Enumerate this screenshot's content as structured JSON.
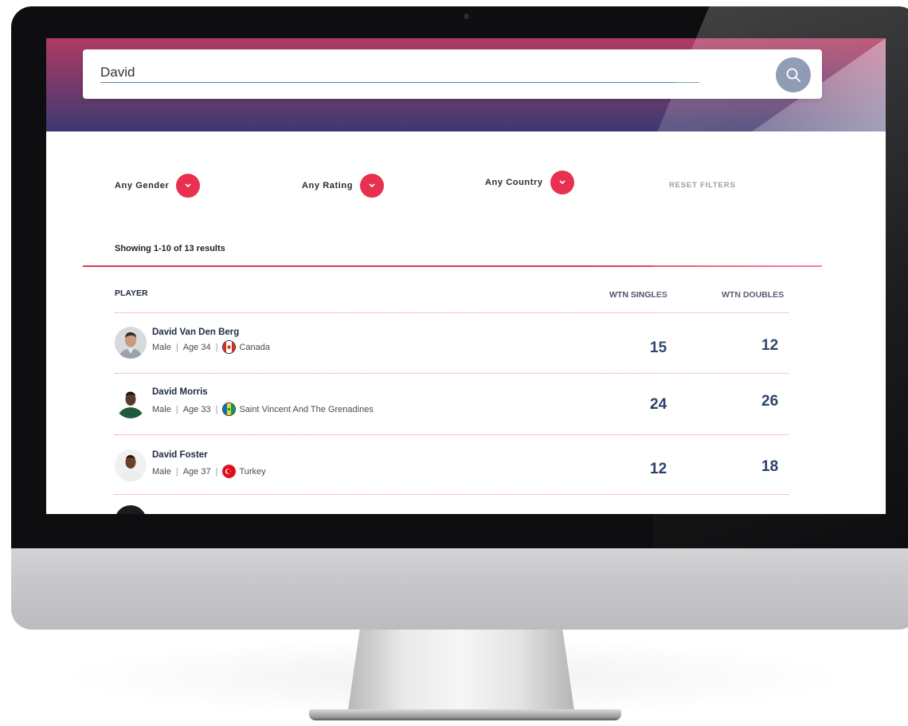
{
  "search": {
    "value": "David"
  },
  "filters": {
    "gender": "Any Gender",
    "rating": "Any Rating",
    "country": "Any Country",
    "reset": "RESET FILTERS"
  },
  "results": {
    "summary": "Showing 1-10 of 13 results"
  },
  "columns": {
    "player": "PLAYER",
    "singles": "WTN SINGLES",
    "doubles": "WTN DOUBLES"
  },
  "players": [
    {
      "name": "David Van Den Berg",
      "gender": "Male",
      "age": "Age 34",
      "country": "Canada",
      "singles": "15",
      "doubles": "12"
    },
    {
      "name": "David Morris",
      "gender": "Male",
      "age": "Age 33",
      "country": "Saint Vincent And The Grenadines",
      "singles": "24",
      "doubles": "26"
    },
    {
      "name": "David Foster",
      "gender": "Male",
      "age": "Age 37",
      "country": "Turkey",
      "singles": "12",
      "doubles": "18"
    }
  ],
  "meta_separator": "|",
  "colors": {
    "accent": "#e8304f",
    "score": "#233a63",
    "hero_top": "#b13a62",
    "hero_bottom": "#3b3a70"
  },
  "icons": {
    "search": "magnifier-icon",
    "dropdown": "chevron-down-icon"
  }
}
